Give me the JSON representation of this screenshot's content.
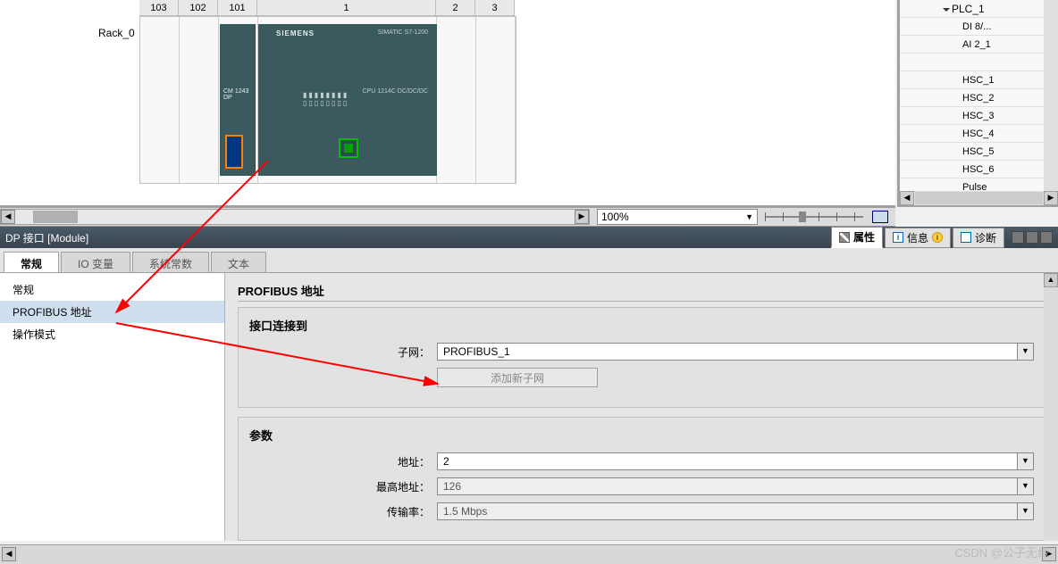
{
  "hw": {
    "rack_label": "Rack_0",
    "slots": [
      "103",
      "102",
      "101",
      "1",
      "2",
      "3"
    ],
    "brand": "SIEMENS",
    "model": "SIMATIC S7-1200",
    "cm": "CM 1243\nDP",
    "cpu": "CPU 1214C\nDC/DC/DC"
  },
  "tree": {
    "head": "PLC_1",
    "items": [
      "DI 8/...",
      "AI 2_1",
      "",
      "HSC_1",
      "HSC_2",
      "HSC_3",
      "HSC_4",
      "HSC_5",
      "HSC_6",
      "Pulse"
    ]
  },
  "zoom": {
    "value": "100%"
  },
  "module": {
    "title": "DP 接口 [Module]"
  },
  "mod_tabs": {
    "props": "属性",
    "info": "信息",
    "diag": "诊断"
  },
  "prop_tabs": {
    "general": "常规",
    "io": "IO 变量",
    "sysconst": "系统常数",
    "text": "文本"
  },
  "nav": {
    "general": "常规",
    "profibus": "PROFIBUS 地址",
    "mode": "操作模式"
  },
  "content": {
    "title": "PROFIBUS 地址",
    "grp1": "接口连接到",
    "subnet_label": "子网：",
    "subnet_value": "PROFIBUS_1",
    "add_subnet": "添加新子网",
    "grp2": "参数",
    "addr_label": "地址：",
    "addr_value": "2",
    "maxaddr_label": "最高地址：",
    "maxaddr_value": "126",
    "baud_label": "传输率：",
    "baud_value": "1.5 Mbps"
  },
  "watermark": "CSDN @公子无缘"
}
